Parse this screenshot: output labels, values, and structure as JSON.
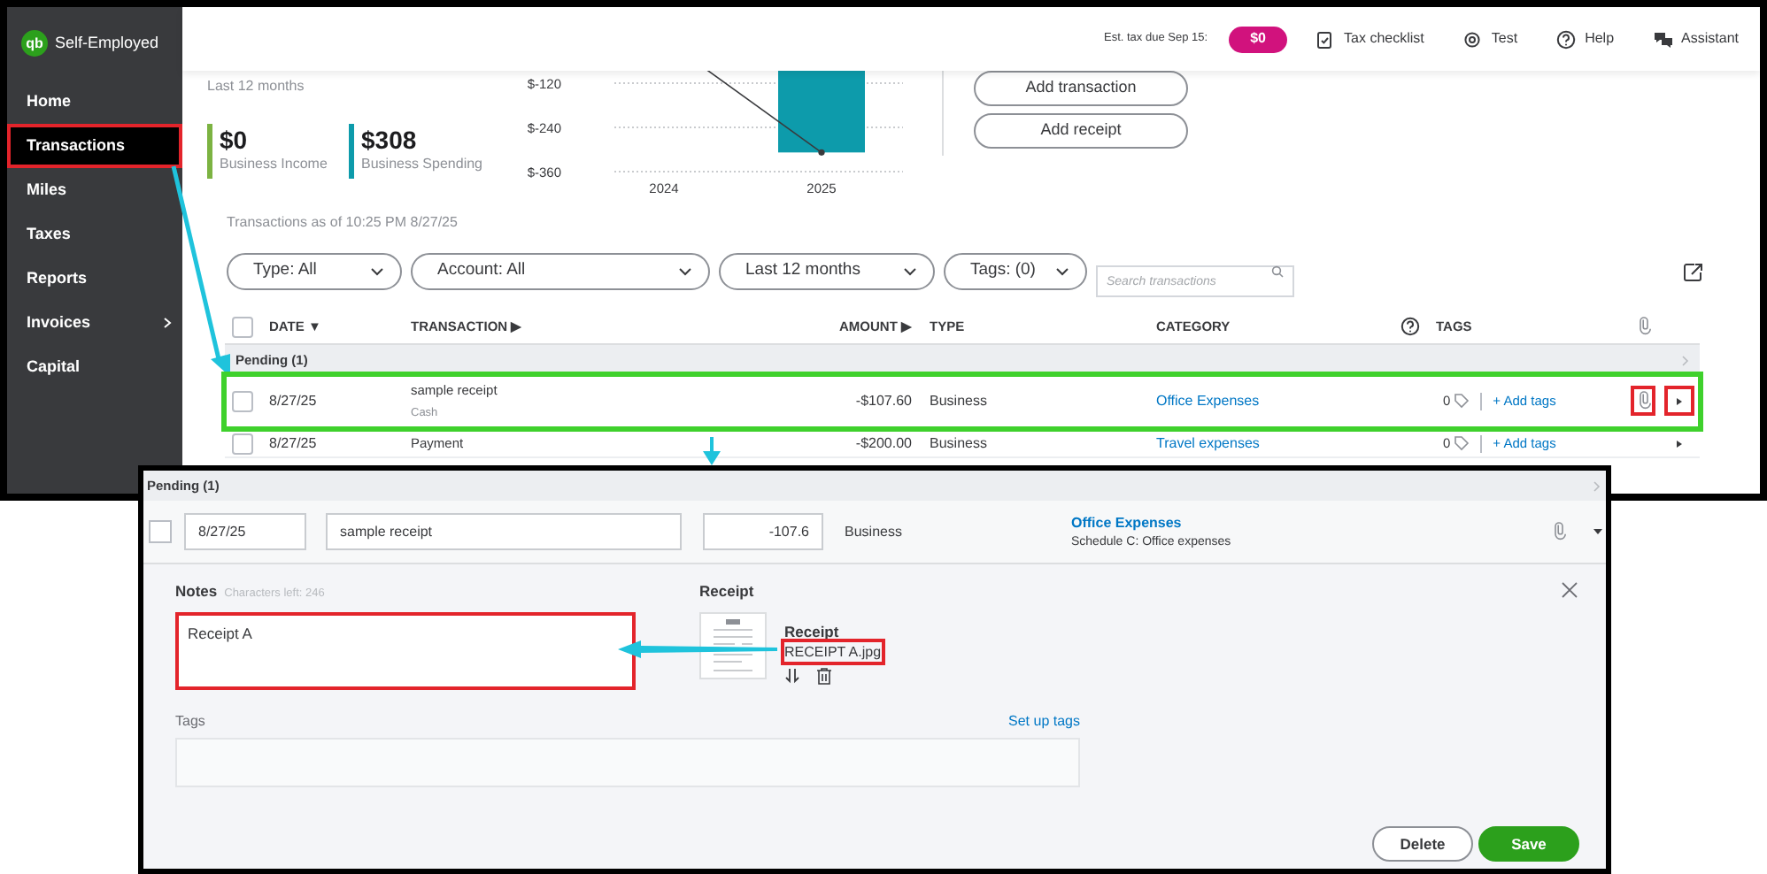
{
  "sidebar": {
    "logo": "qb",
    "brand": "Self-Employed",
    "items": [
      {
        "label": "Home",
        "selected": false,
        "expandable": false,
        "highlighted": false
      },
      {
        "label": "Transactions",
        "selected": true,
        "expandable": false,
        "highlighted": true
      },
      {
        "label": "Miles",
        "selected": false,
        "expandable": false,
        "highlighted": false
      },
      {
        "label": "Taxes",
        "selected": false,
        "expandable": false,
        "highlighted": false
      },
      {
        "label": "Reports",
        "selected": false,
        "expandable": false,
        "highlighted": false
      },
      {
        "label": "Invoices",
        "selected": false,
        "expandable": true,
        "highlighted": false
      },
      {
        "label": "Capital",
        "selected": false,
        "expandable": false,
        "highlighted": false
      }
    ]
  },
  "header": {
    "tax_label": "Est. tax due Sep 15:",
    "tax_due": "$0",
    "links": [
      {
        "label": "Tax checklist",
        "kind": "checklist"
      },
      {
        "label": "Test",
        "kind": "settings"
      },
      {
        "label": "Help",
        "kind": "help"
      },
      {
        "label": "Assistant",
        "kind": "chat"
      }
    ]
  },
  "summary": {
    "period": "Last 12 months",
    "metrics": [
      {
        "value": "$0",
        "label": "Business Income",
        "color": "#7cb342"
      },
      {
        "value": "$308",
        "label": "Business Spending",
        "color": "#0d9bab"
      }
    ],
    "chart_data": {
      "type": "bar",
      "categories": [
        "2024",
        "2025"
      ],
      "series": [
        {
          "color": "#0d9bab",
          "values": [
            0,
            -308
          ]
        }
      ],
      "ylim": [
        -360,
        0
      ],
      "yticks": [
        {
          "value": -120,
          "label": "$-120"
        },
        {
          "value": -240,
          "label": "$-240"
        },
        {
          "value": -360,
          "label": "$-360"
        }
      ]
    },
    "actions": [
      "Add transaction",
      "Add receipt"
    ]
  },
  "transactions": {
    "as_of": "Transactions as of 10:25 PM 8/27/25",
    "filters": [
      "Type: All",
      "Account: All",
      "Last 12 months",
      "Tags: (0)"
    ],
    "search": {
      "placeholder": "Search transactions"
    },
    "select_all_checked": false,
    "columns": [
      "DATE ▼",
      "TRANSACTION ▶",
      "AMOUNT ▶",
      "TYPE",
      "CATEGORY",
      "TAGS"
    ],
    "group": "Pending (1)",
    "rows": [
      {
        "checked": false,
        "date": "8/27/25",
        "transaction": "sample receipt",
        "account": "Cash",
        "amount": "-$107.60",
        "type": "Business",
        "category": "Office Expenses",
        "tag_count": "0",
        "add_tags": "+ Add tags",
        "has_receipt": true,
        "highlighted": true,
        "receipt_highlighted": true,
        "expand_highlighted": true
      },
      {
        "checked": false,
        "date": "8/27/25",
        "transaction": "Payment",
        "amount": "-$200.00",
        "type": "Business",
        "category": "Travel expenses",
        "tag_count": "0",
        "add_tags": "+ Add tags",
        "has_receipt": false,
        "highlighted": false,
        "expand_highlighted": false
      }
    ]
  },
  "editor": {
    "group": "Pending (1)",
    "checked": false,
    "date": "8/27/25",
    "description": "sample receipt",
    "amount": "-107.6",
    "type": "Business",
    "category": "Office Expenses",
    "category_detail": "Schedule C: Office expenses",
    "notes": {
      "label": "Notes",
      "counter": "Characters left: 246",
      "value": "Receipt A",
      "highlighted": true
    },
    "receipt": {
      "heading": "Receipt",
      "title": "Receipt",
      "file": "RECEIPT A.jpg",
      "highlighted": true
    },
    "tags": {
      "label": "Tags",
      "link": "Set up tags"
    },
    "buttons": [
      {
        "label": "Delete",
        "kind": "secondary"
      },
      {
        "label": "Save",
        "kind": "primary"
      }
    ]
  }
}
